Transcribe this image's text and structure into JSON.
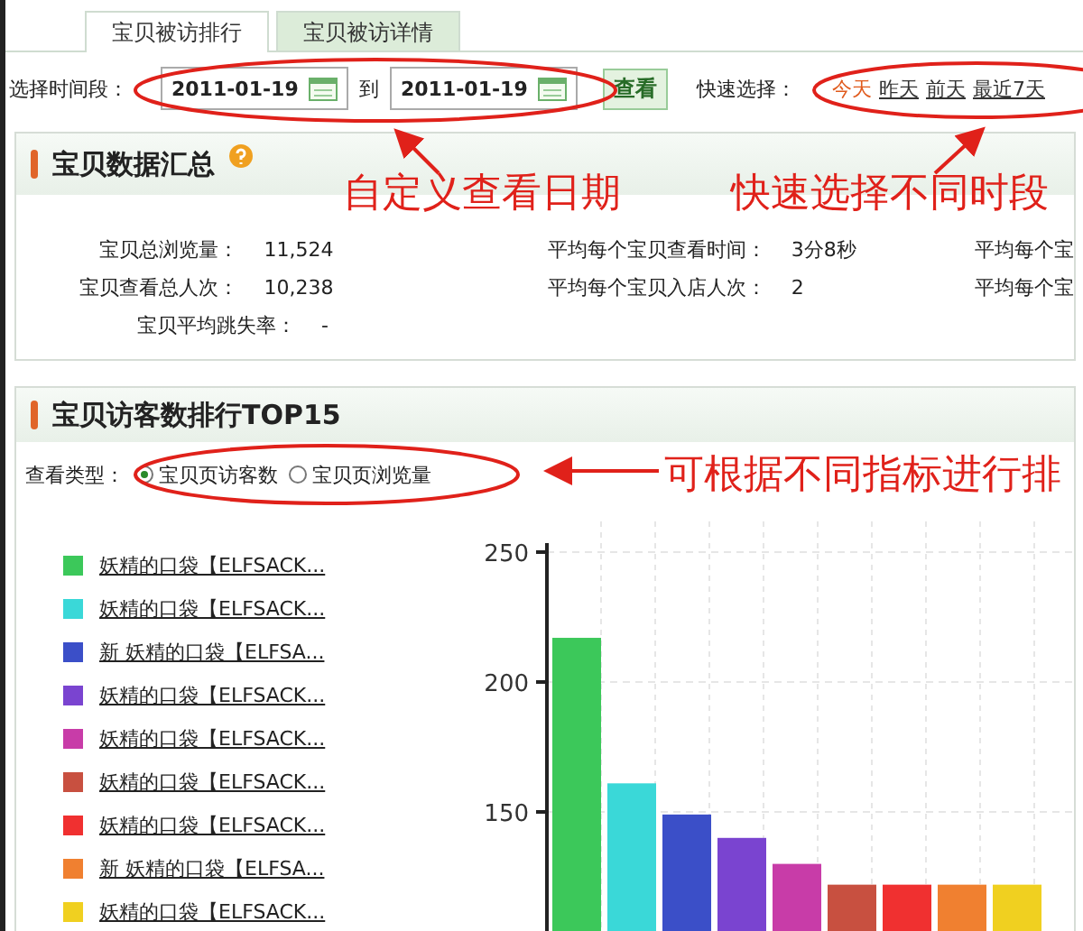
{
  "tabs": [
    {
      "label": "宝贝被访排行",
      "selected": true
    },
    {
      "label": "宝贝被访详情",
      "selected": false
    }
  ],
  "filter": {
    "label": "选择时间段：",
    "start_date": "2011-01-19",
    "separator": "到",
    "end_date": "2011-01-19",
    "view_button": "查看",
    "quick_label": "快速选择：",
    "quick_options": [
      "今天",
      "昨天",
      "前天",
      "最近7天"
    ]
  },
  "summary": {
    "title": "宝贝数据汇总",
    "rows": [
      [
        {
          "label": "宝贝总浏览量：",
          "value": "11,524"
        },
        {
          "label": "平均每个宝贝查看时间：",
          "value": "3分8秒"
        },
        {
          "label": "平均每个宝"
        }
      ],
      [
        {
          "label": "宝贝查看总人次：",
          "value": "10,238"
        },
        {
          "label": "平均每个宝贝入店人次：",
          "value": "2"
        },
        {
          "label": "平均每个宝"
        }
      ],
      [
        {
          "label": "宝贝平均跳失率：",
          "value": "-"
        }
      ]
    ]
  },
  "ranking": {
    "title": "宝贝访客数排行TOP15",
    "view_type_label": "查看类型：",
    "view_types": [
      {
        "label": "宝贝页访客数",
        "selected": true
      },
      {
        "label": "宝贝页浏览量",
        "selected": false
      }
    ],
    "legend": [
      {
        "name": "妖精的口袋【ELFSACK...",
        "color": "#3cc85a"
      },
      {
        "name": "妖精的口袋【ELFSACK...",
        "color": "#3ad8d8"
      },
      {
        "name": "新 妖精的口袋【ELFSA...",
        "color": "#3b4fc8"
      },
      {
        "name": "妖精的口袋【ELFSACK...",
        "color": "#7a44d0"
      },
      {
        "name": "妖精的口袋【ELFSACK...",
        "color": "#c83ca8"
      },
      {
        "name": "妖精的口袋【ELFSACK...",
        "color": "#c85040"
      },
      {
        "name": "妖精的口袋【ELFSACK...",
        "color": "#f03030"
      },
      {
        "name": "新 妖精的口袋【ELFSA...",
        "color": "#f08030"
      },
      {
        "name": "妖精的口袋【ELFSACK...",
        "color": "#f0d020"
      }
    ],
    "chart_data": {
      "type": "bar",
      "grid": true,
      "values": [
        217,
        161,
        149,
        140,
        130,
        122,
        122,
        122,
        122
      ],
      "ylim": [
        100,
        250
      ],
      "yticks": [
        150,
        200,
        250
      ]
    }
  },
  "annotations": [
    "自定义查看日期",
    "快速选择不同时段",
    "可根据不同指标进行排"
  ]
}
